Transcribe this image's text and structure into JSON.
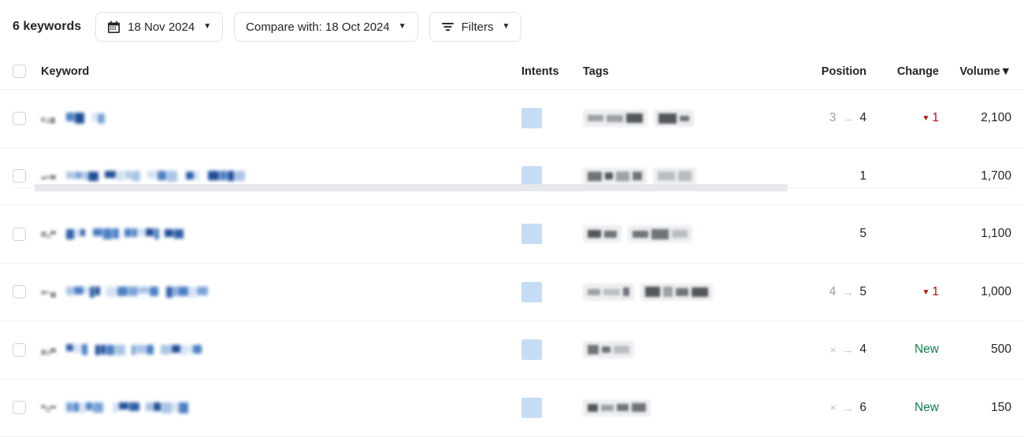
{
  "toolbar": {
    "keyword_count": "6 keywords",
    "date_button": {
      "label": "18 Nov 2024",
      "icon": "calendar-icon",
      "caret": "▼"
    },
    "compare_button": {
      "label": "Compare with: 18 Oct 2024",
      "caret": "▼"
    },
    "filters_button": {
      "label": "Filters",
      "icon": "filter-icon",
      "caret": "▼"
    }
  },
  "table": {
    "columns": {
      "keyword": "Keyword",
      "intents": "Intents",
      "tags": "Tags",
      "position": "Position",
      "change": "Change",
      "volume": "Volume",
      "volume_sort_caret": "▼"
    },
    "sorted_by": "Volume",
    "sort_direction": "desc",
    "rows": [
      {
        "keyword": "[redacted]",
        "intents": "[redacted-badge]",
        "tags": "[redacted] [redacted]",
        "tag_count": 2,
        "position_from": "3",
        "position_arrow": "→",
        "position_to": "4",
        "change": "1",
        "change_type": "down",
        "change_icon": "▼",
        "volume": "2,100"
      },
      {
        "keyword": "[redacted]",
        "intents": "[redacted-badge]",
        "tags": "[redacted] [redacted]",
        "tag_count": 2,
        "position_from": "",
        "position_arrow": "",
        "position_to": "1",
        "change": "",
        "change_type": "none",
        "change_icon": "",
        "volume": "1,700"
      },
      {
        "keyword": "[redacted]",
        "intents": "[redacted-badge]",
        "tags": "[redacted] [redacted]",
        "tag_count": 2,
        "position_from": "",
        "position_arrow": "",
        "position_to": "5",
        "change": "",
        "change_type": "none",
        "change_icon": "",
        "volume": "1,100"
      },
      {
        "keyword": "[redacted]",
        "intents": "[redacted-badge]",
        "tags": "[redacted] [redacted]",
        "tag_count": 2,
        "position_from": "4",
        "position_arrow": "→",
        "position_to": "5",
        "change": "1",
        "change_type": "down",
        "change_icon": "▼",
        "volume": "1,000"
      },
      {
        "keyword": "[redacted]",
        "intents": "[redacted-badge]",
        "tags": "[redacted]",
        "tag_count": 1,
        "position_from": "×",
        "position_arrow": "→",
        "position_to": "4",
        "change": "New",
        "change_type": "new",
        "change_icon": "",
        "volume": "500"
      },
      {
        "keyword": "[redacted]",
        "intents": "[redacted-badge]",
        "tags": "[redacted]",
        "tag_count": 1,
        "position_from": "×",
        "position_arrow": "→",
        "position_to": "6",
        "change": "New",
        "change_type": "new",
        "change_icon": "",
        "volume": "150"
      }
    ]
  },
  "colors": {
    "change_down": "#b80c09",
    "change_new": "#118051",
    "intent_badge": "#c6dcf4",
    "tag_chip": "#eceef0",
    "border": "#edeef0",
    "scrollbar": "#e6e8eb"
  },
  "scrollbar": {
    "orientation": "horizontal",
    "name": "table-horizontal-scrollbar"
  }
}
